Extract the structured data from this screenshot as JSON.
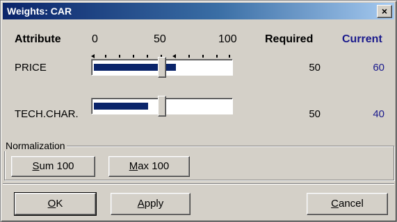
{
  "window": {
    "title": "Weights: CAR",
    "close_glyph": "×"
  },
  "header": {
    "attribute": "Attribute",
    "scale": [
      "0",
      "50",
      "100"
    ],
    "required": "Required",
    "current": "Current"
  },
  "rows": [
    {
      "label": "PRICE",
      "required": "50",
      "current": "60",
      "current_fraction": 0.6,
      "slider_fraction": 0.5
    },
    {
      "label": "TECH.CHAR.",
      "required": "50",
      "current": "40",
      "current_fraction": 0.4,
      "slider_fraction": 0.5
    }
  ],
  "normalization": {
    "legend": "Normalization",
    "sum_button": {
      "accel": "S",
      "rest": "um 100"
    },
    "max_button": {
      "accel": "M",
      "rest": "ax 100"
    }
  },
  "footer": {
    "ok": {
      "accel": "O",
      "rest": "K"
    },
    "apply": {
      "accel": "A",
      "rest": "pply"
    },
    "cancel": {
      "accel": "C",
      "rest": "ancel"
    }
  },
  "colors": {
    "fill": "#0a246a",
    "current_text": "#1a1a8c"
  }
}
